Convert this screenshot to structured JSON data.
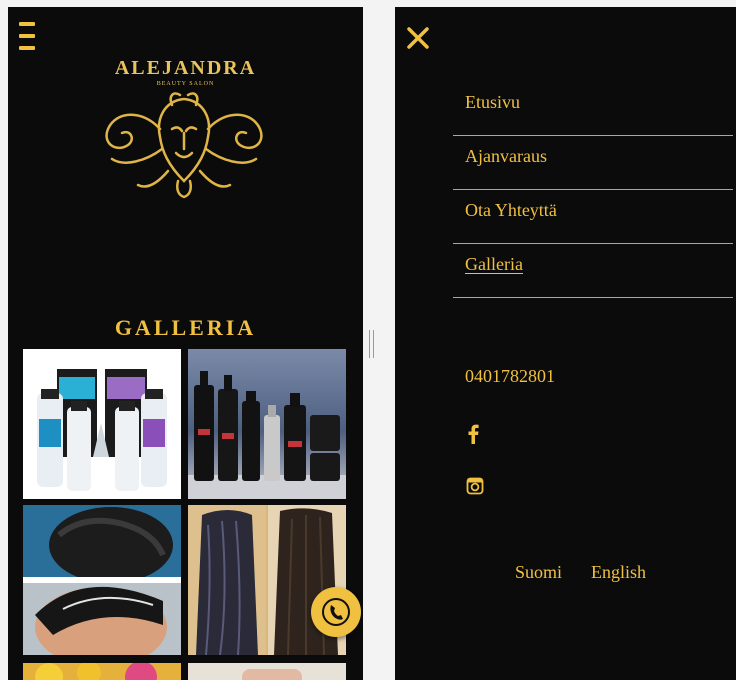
{
  "brand": {
    "name": "ALEJANDRA",
    "subtitle": "BEAUTY SALON"
  },
  "gallery": {
    "title": "GALLERIA"
  },
  "menu": {
    "items": [
      {
        "label": "Etusivu",
        "active": false
      },
      {
        "label": "Ajanvaraus",
        "active": false
      },
      {
        "label": "Ota Yhteyttä",
        "active": false
      },
      {
        "label": "Galleria",
        "active": true
      }
    ]
  },
  "contact": {
    "phone": "0401782801"
  },
  "social": {
    "icons": [
      "facebook-icon",
      "instagram-icon"
    ]
  },
  "languages": [
    "Suomi",
    "English"
  ],
  "colors": {
    "accent": "#f0c040",
    "background": "#0b0b0c"
  }
}
